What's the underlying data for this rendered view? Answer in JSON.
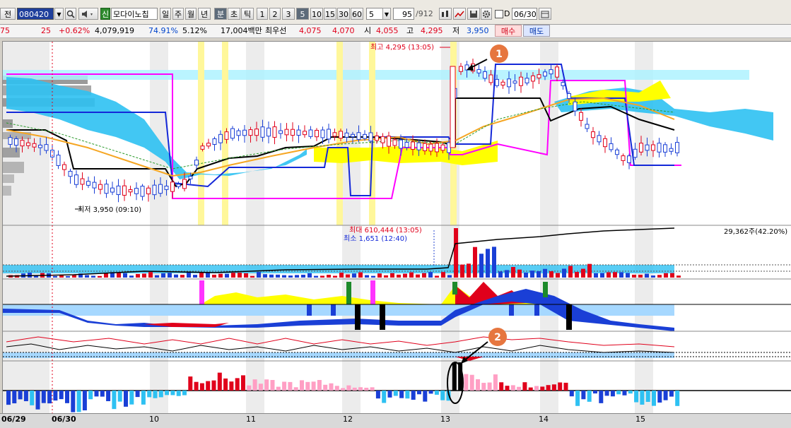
{
  "toolbar": {
    "item_label": "전",
    "code_value": "080420",
    "sound_icon": "speaker-icon",
    "credit_badge": "신",
    "stock_name": "모다이노칩",
    "period_buttons": [
      "일",
      "주",
      "월",
      "년",
      "분",
      "초",
      "틱"
    ],
    "selected_period": "분",
    "interval_buttons": [
      "1",
      "2",
      "3",
      "5",
      "10",
      "15",
      "30",
      "60"
    ],
    "selected_interval": "5",
    "interval_select": "5",
    "count_value": "95",
    "count_total": "/912",
    "checkbox_label": "D",
    "date_value": "06/30"
  },
  "quote": {
    "change_prefix": "75",
    "change_value": "25",
    "change_pct": "+0.62%",
    "volume": "4,079,919",
    "vol_ratio": "74.91%",
    "turnover": "5.12%",
    "amount": "17,004백만",
    "best_bid_label": "최우선",
    "best_ask": "4,075",
    "best_bid": "4,070",
    "open_label": "시",
    "open": "4,055",
    "high_label": "고",
    "high": "4,295",
    "low_label": "저",
    "low": "3,950",
    "buy_button": "매수",
    "sell_button": "매도"
  },
  "annotations": {
    "high_note": "최고 4,295 (13:05)",
    "low_note": "최저 3,950 (09:10)",
    "vol_max_note": "최대 610,444 (13:05)",
    "vol_min_note": "최소 1,651 (12:40)",
    "vol_total_note": "29,362주(42.20%)",
    "marker1": "1",
    "marker2": "2"
  },
  "dates": {
    "labels": [
      "06/29",
      "06/30",
      "10",
      "11",
      "12",
      "13",
      "14",
      "15"
    ]
  },
  "colors": {
    "up": "#e0001b",
    "down": "#1a3fd6",
    "cloud_blue": "#33c0f0",
    "cloud_yellow": "#ffff00",
    "marker_orange": "#e6763f",
    "magenta": "#ff00ff"
  }
}
